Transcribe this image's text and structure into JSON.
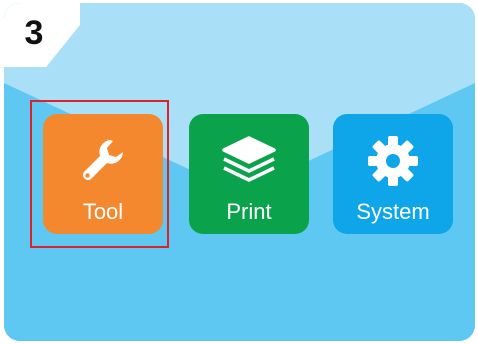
{
  "step": {
    "number": "3"
  },
  "colors": {
    "background": "#5ec8f2",
    "background_fold": "#a9e0f8",
    "highlight": "#d9232d"
  },
  "tiles": [
    {
      "label": "Tool",
      "icon": "wrench-icon",
      "color": "#f3882f",
      "highlighted": true
    },
    {
      "label": "Print",
      "icon": "layers-icon",
      "color": "#0aa24a",
      "highlighted": false
    },
    {
      "label": "System",
      "icon": "gear-icon",
      "color": "#0ea6e8",
      "highlighted": false
    }
  ]
}
